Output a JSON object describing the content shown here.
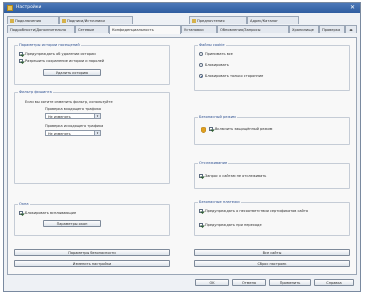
{
  "window": {
    "title": "Настройки"
  },
  "tabs_row1": [
    {
      "label": "Подключения"
    },
    {
      "label": "Подписи/Источники"
    },
    {
      "label": "Предпочтения"
    },
    {
      "label": "Адрес/Каталог"
    }
  ],
  "tabs_row2": [
    {
      "label": "Подробности/Дополнительно"
    },
    {
      "label": "Сетевые"
    },
    {
      "label": "Конфиденциальность"
    },
    {
      "label": "Установки"
    },
    {
      "label": "Обновления/Запросы"
    },
    {
      "label": "Хранилище"
    },
    {
      "label": "Проверка"
    }
  ],
  "groups": {
    "history": {
      "title": "Параметры истории посещений",
      "options": [
        {
          "label": "Предупреждать об удалении истории",
          "checked": true
        },
        {
          "label": "Разрешить сохранение истории и паролей",
          "checked": true
        }
      ],
      "button": "Удалить историю"
    },
    "phishing": {
      "title": "Фильтр фишинга",
      "text": "Если вы хотите изменить фильтр, используйте",
      "select1_label": "Проверка входящего трафика",
      "select1_value": "Не изменять",
      "select2_label": "Проверка исходящего трафика",
      "select2_value": "Не изменять"
    },
    "popups": {
      "title": "Окна",
      "option": {
        "label": "Блокировать всплывающие",
        "checked": true
      },
      "button": "Параметры окон"
    },
    "cookies": {
      "title": "Файлы cookie",
      "options": [
        {
          "label": "Принимать все",
          "checked": false
        },
        {
          "label": "Блокировать",
          "checked": false
        },
        {
          "label": "Блокировать только сторонние",
          "checked": true
        }
      ]
    },
    "security": {
      "title": "Безопасный режим",
      "option": {
        "label": "Включить защищённый режим",
        "checked": true
      }
    },
    "tracking": {
      "title": "Отслеживание",
      "option": {
        "label": "Запрос к сайтам не отслеживать",
        "checked": true
      }
    },
    "payments": {
      "title": "Безопасные платежи",
      "options": [
        {
          "label": "Предупреждать о несоответствии сертификатов сайта",
          "checked": true
        },
        {
          "label": "Предупреждать при переходе",
          "checked": true
        }
      ]
    }
  },
  "bottom_buttons": [
    {
      "label": "Параметры безопасности"
    },
    {
      "label": "Все сайты"
    },
    {
      "label": "Изменить настройки"
    },
    {
      "label": "Сброс настроек"
    }
  ],
  "dialog_buttons": [
    {
      "label": "OK"
    },
    {
      "label": "Отмена"
    },
    {
      "label": "Применить"
    },
    {
      "label": "Справка"
    }
  ]
}
